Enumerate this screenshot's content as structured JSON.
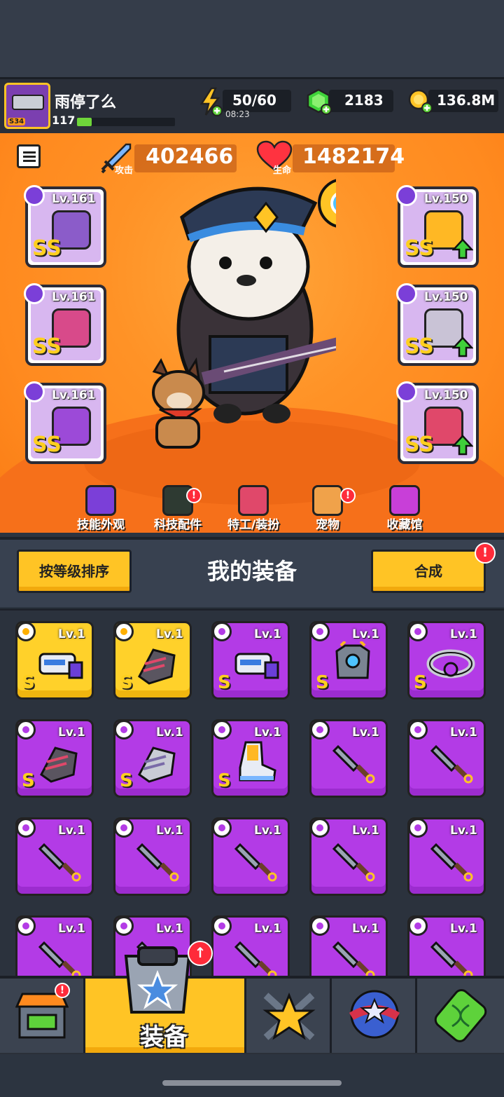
{
  "header": {
    "player_name": "雨停了么",
    "avatar_badge": "S34",
    "player_level": "117",
    "xp_fraction": 0.15,
    "energy": "50/60",
    "energy_timer": "08:23",
    "gems": "2183",
    "coins": "136.8M"
  },
  "hero": {
    "attack_label": "攻击",
    "attack_value": "402466",
    "hp_label": "生命",
    "hp_value": "1482174",
    "left_slots": [
      {
        "level": "Lv.161",
        "grade": "SS"
      },
      {
        "level": "Lv.161",
        "grade": "SS"
      },
      {
        "level": "Lv.161",
        "grade": "SS"
      }
    ],
    "right_slots": [
      {
        "level": "Lv.150",
        "grade": "SS"
      },
      {
        "level": "Lv.150",
        "grade": "SS"
      },
      {
        "level": "Lv.150",
        "grade": "SS"
      }
    ],
    "tabs": [
      {
        "label": "技能外观",
        "badge": ""
      },
      {
        "label": "科技配件",
        "badge": "!"
      },
      {
        "label": "特工/装扮",
        "badge": ""
      },
      {
        "label": "宠物",
        "badge": "!"
      },
      {
        "label": "收藏馆",
        "badge": ""
      }
    ]
  },
  "equipment": {
    "sort_label": "按等级排序",
    "title": "我的装备",
    "synth_label": "合成",
    "synth_badge": "!",
    "items": [
      {
        "level": "Lv.1",
        "grade": "S",
        "rarity": "gold",
        "art": "blaster"
      },
      {
        "level": "Lv.1",
        "grade": "S",
        "rarity": "gold",
        "art": "gauntlet"
      },
      {
        "level": "Lv.1",
        "grade": "S",
        "rarity": "purple",
        "art": "blaster"
      },
      {
        "level": "Lv.1",
        "grade": "S",
        "rarity": "purple",
        "art": "armor"
      },
      {
        "level": "Lv.1",
        "grade": "S",
        "rarity": "purple",
        "art": "belt"
      },
      {
        "level": "Lv.1",
        "grade": "S",
        "rarity": "purple",
        "art": "gauntlet"
      },
      {
        "level": "Lv.1",
        "grade": "S",
        "rarity": "purple",
        "art": "gauntlet-silver"
      },
      {
        "level": "Lv.1",
        "grade": "S",
        "rarity": "purple",
        "art": "boots"
      },
      {
        "level": "Lv.1",
        "grade": "",
        "rarity": "purple",
        "art": "kunai"
      },
      {
        "level": "Lv.1",
        "grade": "",
        "rarity": "purple",
        "art": "kunai"
      },
      {
        "level": "Lv.1",
        "grade": "",
        "rarity": "purple",
        "art": "kunai"
      },
      {
        "level": "Lv.1",
        "grade": "",
        "rarity": "purple",
        "art": "kunai"
      },
      {
        "level": "Lv.1",
        "grade": "",
        "rarity": "purple",
        "art": "kunai"
      },
      {
        "level": "Lv.1",
        "grade": "",
        "rarity": "purple",
        "art": "kunai"
      },
      {
        "level": "Lv.1",
        "grade": "",
        "rarity": "purple",
        "art": "kunai"
      },
      {
        "level": "Lv.1",
        "grade": "",
        "rarity": "purple",
        "art": "kunai"
      },
      {
        "level": "Lv.1",
        "grade": "",
        "rarity": "purple",
        "art": "kunai"
      },
      {
        "level": "Lv.1",
        "grade": "",
        "rarity": "purple",
        "art": "kunai"
      },
      {
        "level": "Lv.1",
        "grade": "",
        "rarity": "purple",
        "art": "kunai"
      },
      {
        "level": "Lv.1",
        "grade": "",
        "rarity": "purple",
        "art": "kunai"
      }
    ]
  },
  "nav": {
    "active_label": "装备",
    "items": [
      "shop-icon",
      "equipment-icon",
      "talent-star-icon",
      "star-orb-icon",
      "dna-capsule-icon"
    ],
    "shop_badge": "!"
  },
  "colors": {
    "gold": "#ffc425",
    "purple": "#b33be6",
    "orange_bg": "#ff9226",
    "dark_panel": "#2b323d"
  }
}
